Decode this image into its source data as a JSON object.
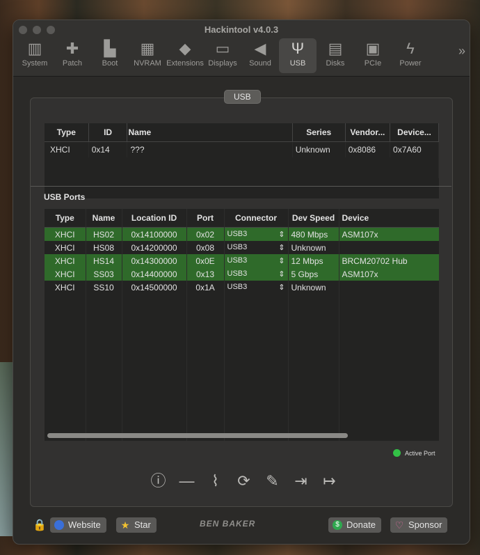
{
  "window": {
    "title": "Hackintool v4.0.3"
  },
  "toolbar": {
    "items": [
      {
        "label": "System",
        "icon": "computer-icon",
        "glyph": "▥"
      },
      {
        "label": "Patch",
        "icon": "bandage-icon",
        "glyph": "✚"
      },
      {
        "label": "Boot",
        "icon": "boot-icon",
        "glyph": "▙"
      },
      {
        "label": "NVRAM",
        "icon": "memory-icon",
        "glyph": "▦"
      },
      {
        "label": "Extensions",
        "icon": "lego-brick-icon",
        "glyph": "◆"
      },
      {
        "label": "Displays",
        "icon": "display-icon",
        "glyph": "▭"
      },
      {
        "label": "Sound",
        "icon": "speaker-icon",
        "glyph": "◀"
      },
      {
        "label": "USB",
        "icon": "usb-icon",
        "glyph": "Ψ"
      },
      {
        "label": "Disks",
        "icon": "disk-icon",
        "glyph": "▤"
      },
      {
        "label": "PCIe",
        "icon": "pcie-card-icon",
        "glyph": "▣"
      },
      {
        "label": "Power",
        "icon": "power-bolt-icon",
        "glyph": "ϟ"
      }
    ],
    "more_glyph": "»",
    "active": "USB"
  },
  "section": {
    "label": "USB"
  },
  "controllers": {
    "headers": [
      "Type",
      "ID",
      "Name",
      "Series",
      "Vendor...",
      "Device..."
    ],
    "rows": [
      {
        "type": "XHCI",
        "id": "0x14",
        "name": "???",
        "series": "Unknown",
        "vendor": "0x8086",
        "device": "0x7A60"
      }
    ]
  },
  "ports": {
    "title": "USB Ports",
    "headers": [
      "Type",
      "Name",
      "Location ID",
      "Port",
      "Connector",
      "Dev Speed",
      "Device"
    ],
    "rows": [
      {
        "type": "XHCI",
        "name": "HS02",
        "location": "0x14100000",
        "port": "0x02",
        "connector": "USB3",
        "speed": "480 Mbps",
        "device": "ASM107x",
        "active": true
      },
      {
        "type": "XHCI",
        "name": "HS08",
        "location": "0x14200000",
        "port": "0x08",
        "connector": "USB3",
        "speed": "Unknown",
        "device": "",
        "active": false
      },
      {
        "type": "XHCI",
        "name": "HS14",
        "location": "0x14300000",
        "port": "0x0E",
        "connector": "USB3",
        "speed": "12 Mbps",
        "device": "BRCM20702 Hub",
        "active": true
      },
      {
        "type": "XHCI",
        "name": "SS03",
        "location": "0x14400000",
        "port": "0x13",
        "connector": "USB3",
        "speed": "5 Gbps",
        "device": "ASM107x",
        "active": true
      },
      {
        "type": "XHCI",
        "name": "SS10",
        "location": "0x14500000",
        "port": "0x1A",
        "connector": "USB3",
        "speed": "Unknown",
        "device": "",
        "active": false
      }
    ]
  },
  "legend": {
    "label": "Active Port",
    "color": "#33c146"
  },
  "actions": [
    {
      "name": "info-icon",
      "glyph": "ⓘ"
    },
    {
      "name": "remove-icon",
      "glyph": "—"
    },
    {
      "name": "broom-icon",
      "glyph": "⌇"
    },
    {
      "name": "refresh-icon",
      "glyph": "⟳"
    },
    {
      "name": "syringe-icon",
      "glyph": "✎"
    },
    {
      "name": "import-icon",
      "glyph": "⇥"
    },
    {
      "name": "export-icon",
      "glyph": "↦"
    }
  ],
  "footer": {
    "website": "Website",
    "star": "Star",
    "brand": "BEN BAKER",
    "donate": "Donate",
    "sponsor": "Sponsor"
  },
  "colors": {
    "active_row": "#2f6a2a",
    "active_dot": "#33c146"
  }
}
